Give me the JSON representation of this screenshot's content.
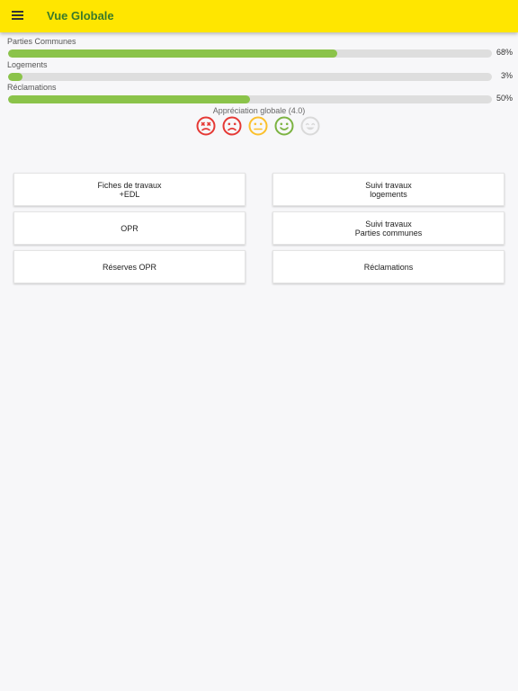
{
  "header": {
    "title": "Vue Globale",
    "menu_icon": "hamburger-menu-icon"
  },
  "progress": [
    {
      "label": "Parties Communes",
      "percent_text": "68%",
      "value": 68,
      "color": "#8bc34a"
    },
    {
      "label": "Logements",
      "percent_text": "3%",
      "value": 3,
      "color": "#8bc34a"
    },
    {
      "label": "Réclamations",
      "percent_text": "50%",
      "value": 50,
      "color": "#8bc34a"
    }
  ],
  "rating": {
    "label": "Appréciation globale (4.0)",
    "value": 4.0,
    "icons": [
      {
        "name": "dead-face-icon",
        "color": "#e53935"
      },
      {
        "name": "sad-face-icon",
        "color": "#e53935"
      },
      {
        "name": "neutral-face-icon",
        "color": "#fbc02d"
      },
      {
        "name": "happy-face-icon",
        "color": "#7cb342"
      },
      {
        "name": "very-happy-face-icon",
        "color": "#d9d9d9"
      }
    ]
  },
  "buttons": {
    "fiches": {
      "line1": "Fiches de travaux",
      "line2": "+EDL"
    },
    "suivi_logements": {
      "line1": "Suivi travaux",
      "line2": "logements"
    },
    "opr": {
      "line1": "OPR"
    },
    "suivi_parties": {
      "line1": "Suivi travaux",
      "line2": "Parties communes"
    },
    "reserves": {
      "line1": "Réserves OPR"
    },
    "reclamations": {
      "line1": "Réclamations"
    }
  }
}
